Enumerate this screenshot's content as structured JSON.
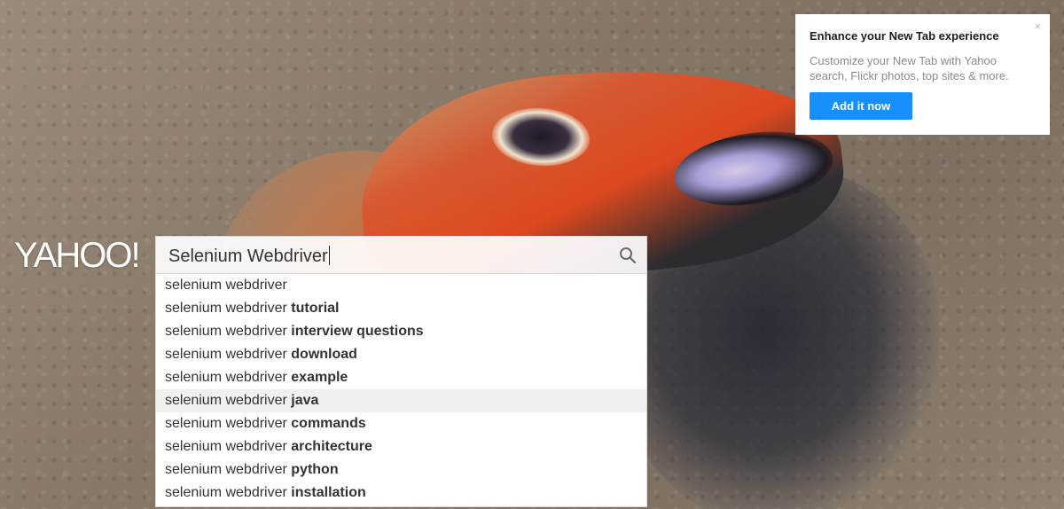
{
  "logo": {
    "text": "YAHOO!"
  },
  "search": {
    "query": "Selenium Webdriver",
    "icon": "search-icon"
  },
  "suggestions": [
    {
      "prefix": "selenium webdriver",
      "bold": ""
    },
    {
      "prefix": "selenium webdriver ",
      "bold": "tutorial"
    },
    {
      "prefix": "selenium webdriver ",
      "bold": "interview questions"
    },
    {
      "prefix": "selenium webdriver ",
      "bold": "download"
    },
    {
      "prefix": "selenium webdriver ",
      "bold": "example"
    },
    {
      "prefix": "selenium webdriver ",
      "bold": "java"
    },
    {
      "prefix": "selenium webdriver ",
      "bold": "commands"
    },
    {
      "prefix": "selenium webdriver ",
      "bold": "architecture"
    },
    {
      "prefix": "selenium webdriver ",
      "bold": "python"
    },
    {
      "prefix": "selenium webdriver ",
      "bold": "installation"
    }
  ],
  "highlighted_suggestion": 5,
  "promo": {
    "title": "Enhance your New Tab experience",
    "description": "Customize your New Tab with Yahoo search, Flickr photos, top sites & more.",
    "button_label": "Add it now",
    "close_label": "×"
  },
  "colors": {
    "accent": "#188fff",
    "highlight": "#f0f0f0"
  }
}
